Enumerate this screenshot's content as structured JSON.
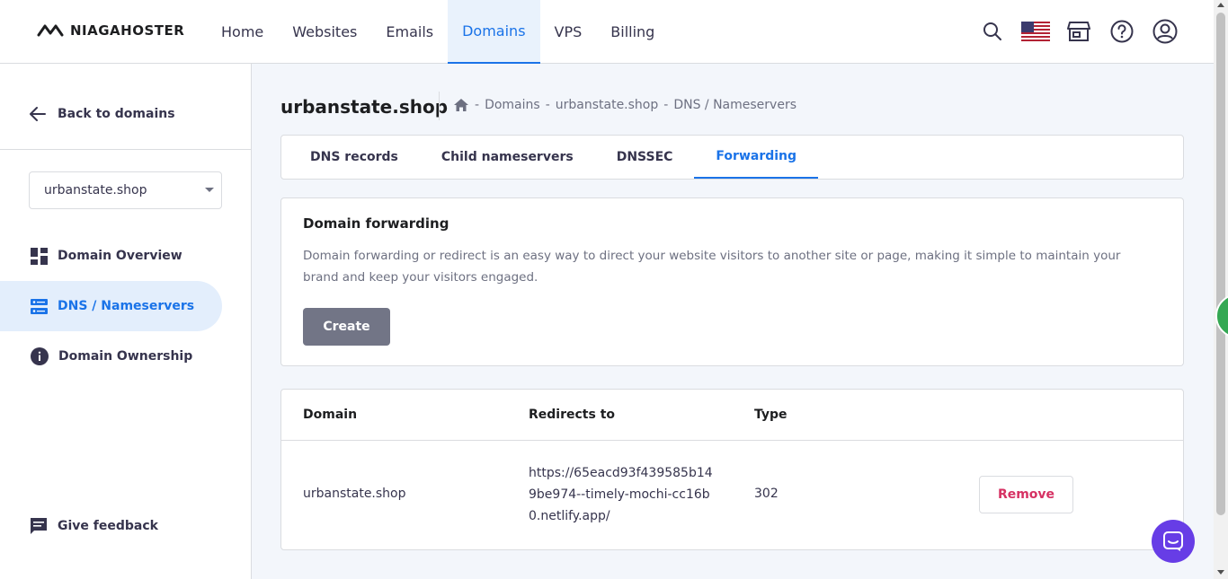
{
  "brand": {
    "name": "NIAGAHOSTER"
  },
  "nav": {
    "items": [
      {
        "label": "Home"
      },
      {
        "label": "Websites"
      },
      {
        "label": "Emails"
      },
      {
        "label": "Domains",
        "active": true
      },
      {
        "label": "VPS"
      },
      {
        "label": "Billing"
      }
    ]
  },
  "top_icons": [
    "search-icon",
    "us-flag-icon",
    "store-icon",
    "help-icon",
    "account-icon"
  ],
  "sidebar": {
    "back_label": "Back to domains",
    "selected_domain": "urbanstate.shop",
    "items": [
      {
        "label": "Domain Overview",
        "icon": "grid-icon"
      },
      {
        "label": "DNS / Nameservers",
        "icon": "dns-icon",
        "active": true
      },
      {
        "label": "Domain Ownership",
        "icon": "info-icon"
      }
    ],
    "feedback_label": "Give feedback"
  },
  "main": {
    "title": "urbanstate.shop",
    "breadcrumb": [
      "Domains",
      "urbanstate.shop",
      "DNS / Nameservers"
    ],
    "tabs": [
      {
        "label": "DNS records"
      },
      {
        "label": "Child nameservers"
      },
      {
        "label": "DNSSEC"
      },
      {
        "label": "Forwarding",
        "active": true
      }
    ],
    "forwarding": {
      "heading": "Domain forwarding",
      "description": "Domain forwarding or redirect is an easy way to direct your website visitors to another site or page, making it simple to maintain your brand and keep your visitors engaged.",
      "create_label": "Create"
    },
    "table": {
      "headers": {
        "domain": "Domain",
        "redirects": "Redirects to",
        "type": "Type"
      },
      "rows": [
        {
          "domain": "urbanstate.shop",
          "redirects": "https://65eacd93f439585b149be974--timely-mochi-cc16b0.netlify.app/",
          "type": "302",
          "remove_label": "Remove"
        }
      ]
    }
  },
  "colors": {
    "accent": "#1a73e8",
    "brand_purple": "#673de6",
    "remove_red": "#d63163",
    "create_gray": "#727586"
  }
}
